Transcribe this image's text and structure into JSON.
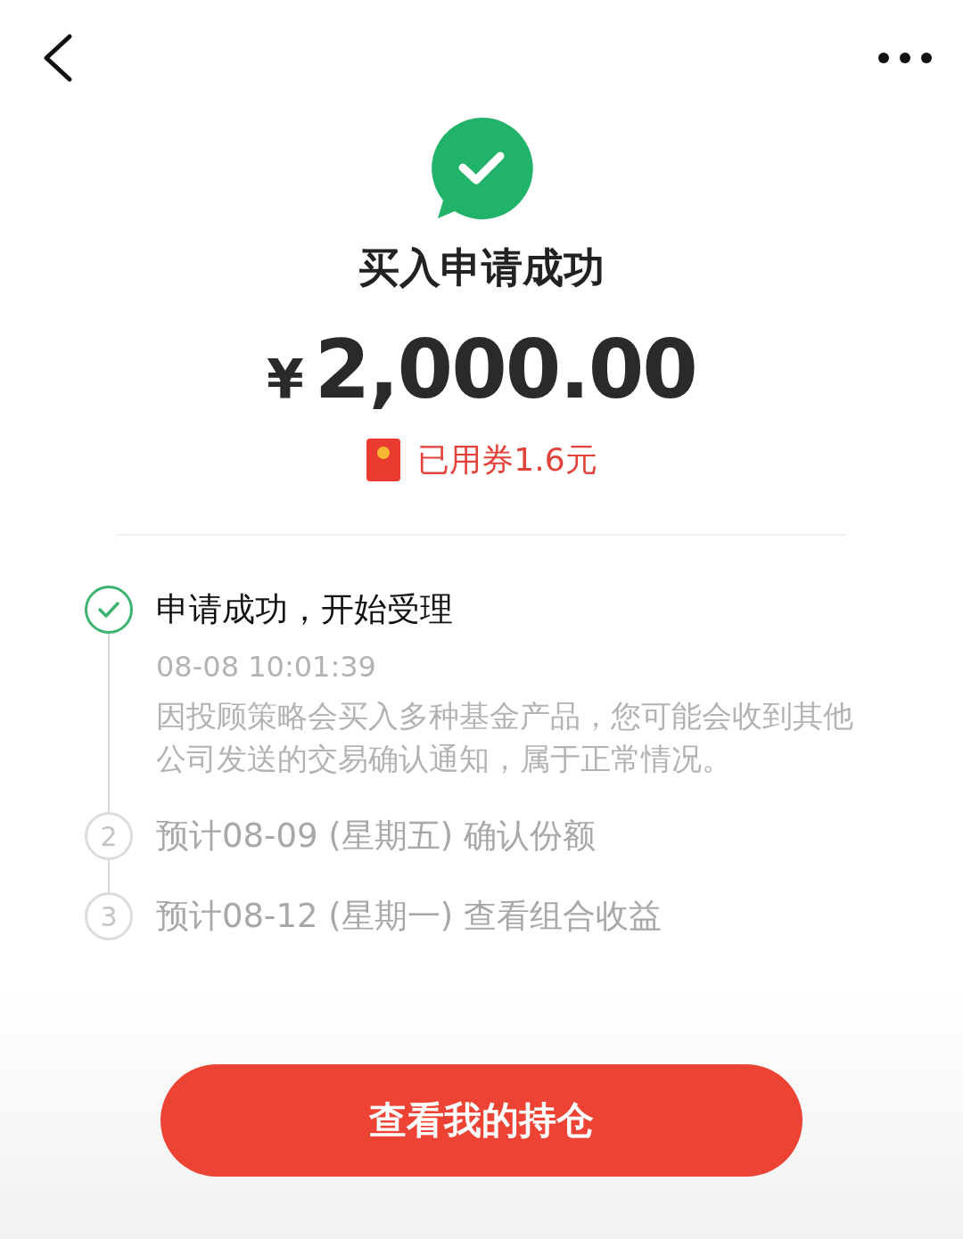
{
  "status": {
    "title": "买入申请成功",
    "currency": "¥",
    "amount": "2,000.00",
    "coupon": "已用券1.6元"
  },
  "steps": [
    {
      "done": true,
      "title": "申请成功，开始受理",
      "time": "08-08 10:01:39",
      "note": "因投顾策略会买入多种基金产品，您可能会收到其他公司发送的交易确认通知，属于正常情况。"
    },
    {
      "done": false,
      "number": "2",
      "title": "预计08-09 (星期五) 确认份额"
    },
    {
      "done": false,
      "number": "3",
      "title": "预计08-12 (星期一) 查看组合收益"
    }
  ],
  "button": "查看我的持仓"
}
